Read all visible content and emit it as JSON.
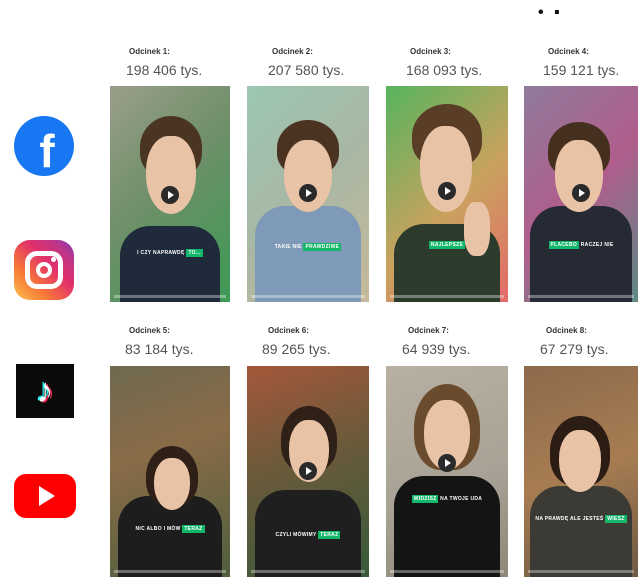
{
  "top_mark": "• ▪",
  "platforms": [
    {
      "name": "facebook",
      "glyph": "f"
    },
    {
      "name": "instagram",
      "glyph": ""
    },
    {
      "name": "tiktok",
      "glyph": "♪"
    },
    {
      "name": "youtube",
      "glyph": ""
    }
  ],
  "episodes": [
    {
      "label": "Odcinek 1:",
      "views": "198 406 tys.",
      "caption_pre": "I CZY NAPRAWDĘ",
      "caption_hl": "TO..."
    },
    {
      "label": "Odcinek 2:",
      "views": "207 580 tys.",
      "caption_pre": "TAKIE NIE",
      "caption_hl": "PRAWDZIWE"
    },
    {
      "label": "Odcinek 3:",
      "views": "168 093 tys.",
      "caption_pre": "",
      "caption_hl": "NAJLEPSZE"
    },
    {
      "label": "Odcinek 4:",
      "views": "159 121 tys.",
      "caption_pre": "",
      "caption_hl": "PLACEBO",
      "caption_post": "RACZEJ NIE"
    },
    {
      "label": "Odcinek 5:",
      "views": "83 184 tys.",
      "caption_pre": "NIC ALBO I MÓW",
      "caption_hl": "TERAZ"
    },
    {
      "label": "Odcinek 6:",
      "views": "89 265 tys.",
      "caption_pre": "CZYLI MÓWIMY",
      "caption_hl": "TERAZ"
    },
    {
      "label": "Odcinek 7:",
      "views": "64 939 tys.",
      "caption_pre": "",
      "caption_hl": "WIDZISZ",
      "caption_post": "NA TWOJE UDA"
    },
    {
      "label": "Odcinek 8:",
      "views": "67 279 tys.",
      "caption_pre": "NA PRAWDĘ ALE JESTEŚ",
      "caption_hl": "WIESZ"
    }
  ]
}
